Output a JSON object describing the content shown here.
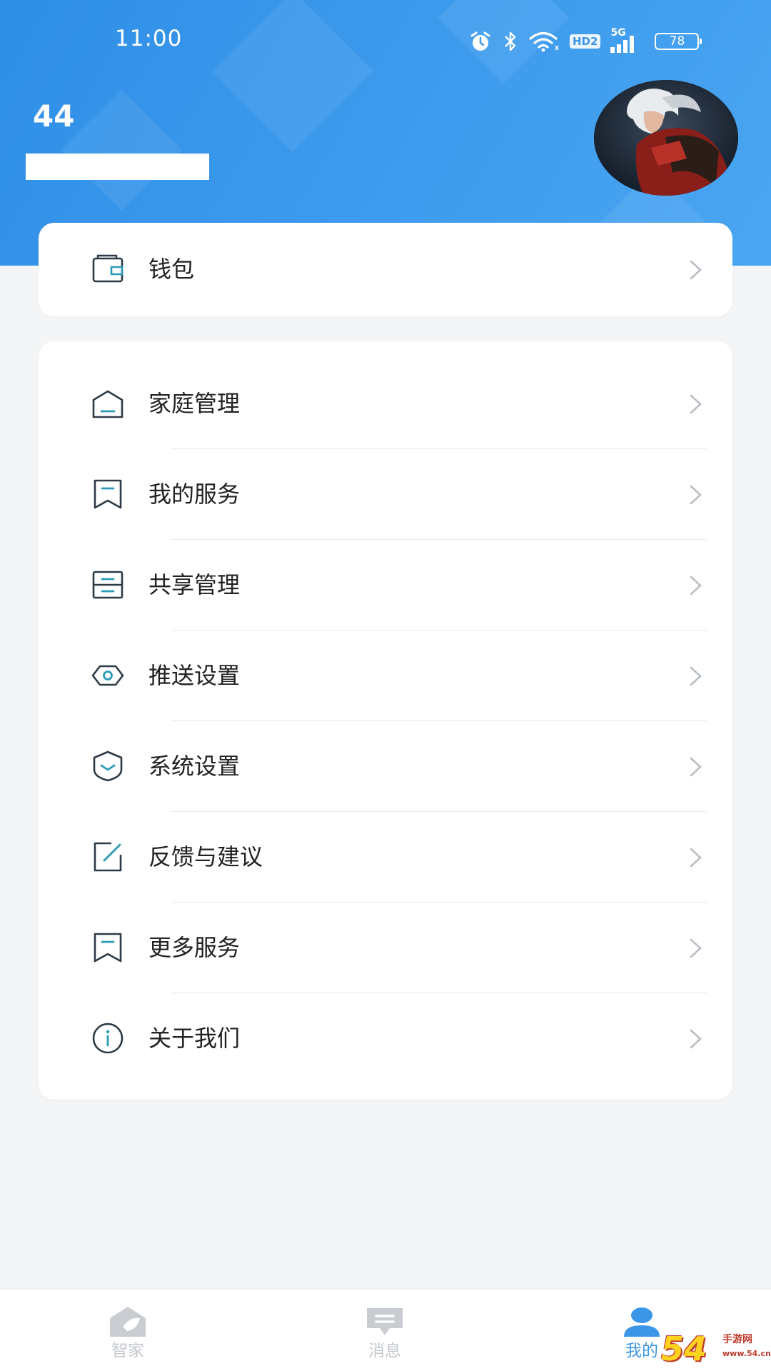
{
  "status_bar": {
    "time": "11:00",
    "network_badge": "HD2",
    "signal_label": "5G",
    "battery": "78",
    "icons": [
      "alarm-icon",
      "bluetooth-icon",
      "wifi-icon",
      "hd-icon",
      "signal-icon",
      "battery-icon"
    ]
  },
  "profile": {
    "number": "44",
    "avatar": "avatar-image"
  },
  "wallet_card": {
    "label": "钱包",
    "icon": "wallet-icon"
  },
  "menu": [
    {
      "label": "家庭管理",
      "icon": "home-icon"
    },
    {
      "label": "我的服务",
      "icon": "bookmark-icon"
    },
    {
      "label": "共享管理",
      "icon": "share-stack-icon"
    },
    {
      "label": "推送设置",
      "icon": "push-icon"
    },
    {
      "label": "系统设置",
      "icon": "shield-icon"
    },
    {
      "label": "反馈与建议",
      "icon": "edit-icon"
    },
    {
      "label": "更多服务",
      "icon": "bookmark-icon"
    },
    {
      "label": "关于我们",
      "icon": "info-icon"
    }
  ],
  "tabbar": {
    "tabs": [
      {
        "label": "智家",
        "icon": "house-leaf-icon",
        "active": false
      },
      {
        "label": "消息",
        "icon": "message-icon",
        "active": false
      },
      {
        "label": "我的",
        "icon": "person-icon",
        "active": true
      }
    ]
  },
  "watermark": {
    "logo": "54",
    "text_top": "手游网",
    "text_bottom": "www.54.cn"
  },
  "colors": {
    "header_blue": "#3a98ec",
    "accent_blue": "#3c96e8",
    "icon_teal": "#2a9bb8",
    "icon_dark": "#2d3a45"
  }
}
